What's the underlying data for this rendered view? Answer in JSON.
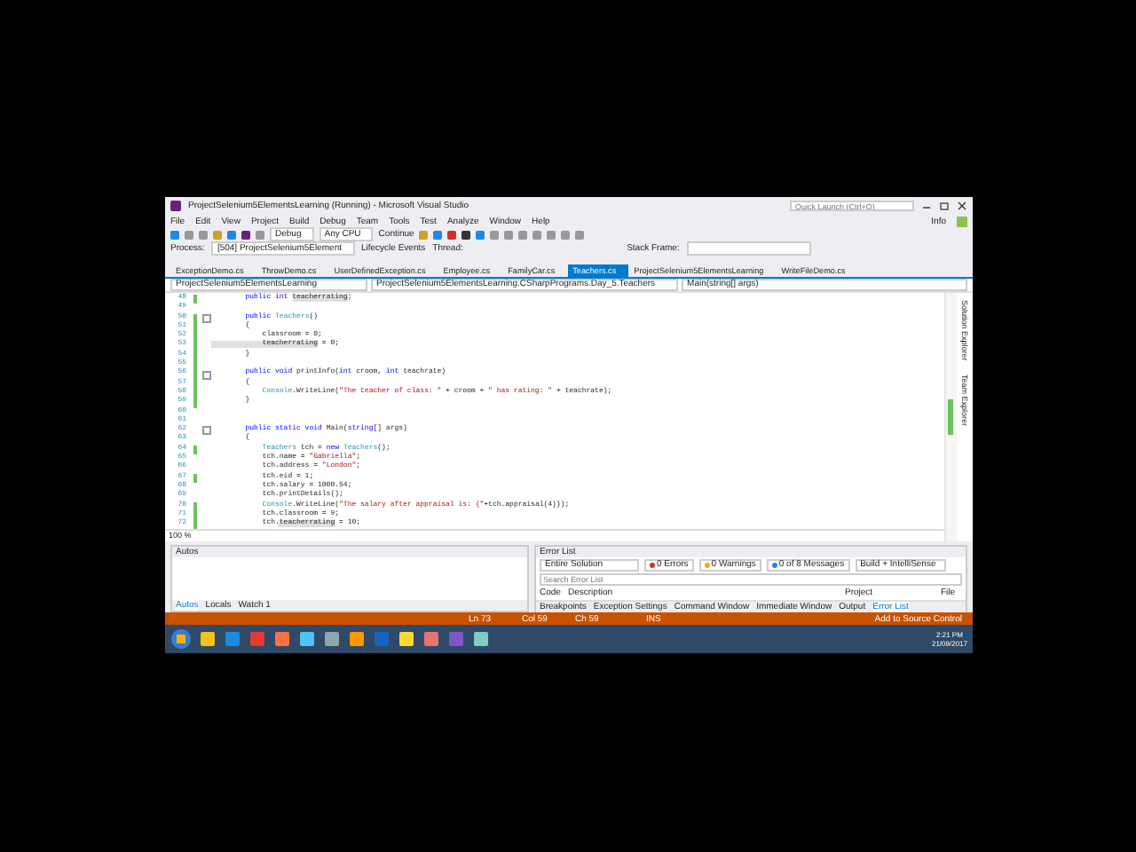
{
  "window": {
    "title": "ProjectSelenium5ElementsLearning (Running) - Microsoft Visual Studio",
    "quick_launch": {
      "placeholder": "Quick Launch (Ctrl+Q)"
    },
    "account": "Info"
  },
  "menu": [
    "File",
    "Edit",
    "View",
    "Project",
    "Build",
    "Debug",
    "Team",
    "Tools",
    "Test",
    "Analyze",
    "Window",
    "Help"
  ],
  "toolbar": {
    "configuration": "Debug",
    "platform": "Any CPU",
    "continue": "Continue"
  },
  "debug_location": {
    "process_label": "Process:",
    "process": "[504] ProjectSelenium5Element",
    "lifecycle": "Lifecycle Events",
    "thread_label": "Thread:",
    "stack_label": "Stack Frame:"
  },
  "tabs": [
    {
      "label": "ExceptionDemo.cs",
      "selected": false
    },
    {
      "label": "ThrowDemo.cs",
      "selected": false
    },
    {
      "label": "UserDefinedException.cs",
      "selected": false
    },
    {
      "label": "Employee.cs",
      "selected": false
    },
    {
      "label": "FamilyCar.cs",
      "selected": false
    },
    {
      "label": "Teachers.cs",
      "selected": true
    },
    {
      "label": "ProjectSelenium5ElementsLearning",
      "selected": false
    },
    {
      "label": "WriteFileDemo.cs",
      "selected": false
    }
  ],
  "navigation": {
    "project": "ProjectSelenium5ElementsLearning",
    "type": "ProjectSelenium5ElementsLearning.CSharpPrograms.Day_5.Teachers",
    "member": "Main(string[] args)"
  },
  "code": {
    "lines": [
      {
        "number": "48",
        "changed": true,
        "fold": false,
        "segs": [
          {
            "text": "        public int ",
            "kind": "kw"
          },
          {
            "text": "teacherrating",
            "kind": "ref"
          },
          {
            "text": ";",
            "kind": "plain"
          }
        ]
      },
      {
        "number": "49",
        "changed": false,
        "fold": false
      },
      {
        "number": "50",
        "changed": true,
        "fold": true,
        "segs": [
          {
            "text": "        public ",
            "kind": "kw"
          },
          {
            "text": "Teachers",
            "kind": "type"
          },
          {
            "text": "()",
            "kind": "plain"
          }
        ]
      },
      {
        "number": "51",
        "changed": true,
        "fold": false,
        "segs": [
          {
            "text": "        {",
            "kind": "plain"
          }
        ]
      },
      {
        "number": "52",
        "changed": true,
        "fold": false,
        "segs": [
          {
            "text": "            classroom = 0;",
            "kind": "plain"
          }
        ]
      },
      {
        "number": "53",
        "changed": true,
        "fold": false,
        "segs": [
          {
            "text": "            teacherrating",
            "kind": "ref"
          },
          {
            "text": " = 0;",
            "kind": "plain"
          }
        ]
      },
      {
        "number": "54",
        "changed": true,
        "fold": false,
        "segs": [
          {
            "text": "        }",
            "kind": "plain"
          }
        ]
      },
      {
        "number": "55",
        "changed": true,
        "fold": false
      },
      {
        "number": "56",
        "changed": true,
        "fold": true,
        "segs": [
          {
            "text": "        public void ",
            "kind": "kw"
          },
          {
            "text": "printInfo(",
            "kind": "plain"
          },
          {
            "text": "int ",
            "kind": "kw"
          },
          {
            "text": "croom, ",
            "kind": "plain"
          },
          {
            "text": "int ",
            "kind": "kw"
          },
          {
            "text": "teachrate)",
            "kind": "plain"
          }
        ]
      },
      {
        "number": "57",
        "changed": true,
        "fold": false,
        "segs": [
          {
            "text": "        {",
            "kind": "plain"
          }
        ]
      },
      {
        "number": "58",
        "changed": true,
        "fold": false,
        "segs": [
          {
            "text": "            Console",
            "kind": "type"
          },
          {
            "text": ".WriteLine(",
            "kind": "plain"
          },
          {
            "text": "\"The teacher of class: \"",
            "kind": "str"
          },
          {
            "text": " + croom + ",
            "kind": "plain"
          },
          {
            "text": "\" has rating: \"",
            "kind": "str"
          },
          {
            "text": " + teachrate);",
            "kind": "plain"
          }
        ]
      },
      {
        "number": "59",
        "changed": true,
        "fold": false,
        "segs": [
          {
            "text": "        }",
            "kind": "plain"
          }
        ]
      },
      {
        "number": "60",
        "changed": false,
        "fold": false
      },
      {
        "number": "61",
        "changed": false,
        "fold": false
      },
      {
        "number": "62",
        "changed": false,
        "fold": true,
        "segs": [
          {
            "text": "        public static void ",
            "kind": "kw"
          },
          {
            "text": "Main(",
            "kind": "plain"
          },
          {
            "text": "string",
            "kind": "kw"
          },
          {
            "text": "[] args)",
            "kind": "plain"
          }
        ]
      },
      {
        "number": "63",
        "changed": false,
        "fold": false,
        "segs": [
          {
            "text": "        {",
            "kind": "plain"
          }
        ]
      },
      {
        "number": "64",
        "changed": true,
        "fold": false,
        "segs": [
          {
            "text": "            Teachers",
            "kind": "type"
          },
          {
            "text": " tch = ",
            "kind": "plain"
          },
          {
            "text": "new ",
            "kind": "kw"
          },
          {
            "text": "Teachers",
            "kind": "type"
          },
          {
            "text": "();",
            "kind": "plain"
          }
        ]
      },
      {
        "number": "65",
        "changed": false,
        "fold": false,
        "segs": [
          {
            "text": "            tch.name = ",
            "kind": "plain"
          },
          {
            "text": "\"Gabriella\"",
            "kind": "str"
          },
          {
            "text": ";",
            "kind": "plain"
          }
        ]
      },
      {
        "number": "66",
        "changed": false,
        "fold": false,
        "segs": [
          {
            "text": "            tch.address = ",
            "kind": "plain"
          },
          {
            "text": "\"London\"",
            "kind": "str"
          },
          {
            "text": ";",
            "kind": "plain"
          }
        ]
      },
      {
        "number": "67",
        "changed": true,
        "fold": false,
        "segs": [
          {
            "text": "            tch.eid = 1;",
            "kind": "plain"
          }
        ]
      },
      {
        "number": "68",
        "changed": false,
        "fold": false,
        "segs": [
          {
            "text": "            tch.salary = 1000.54;",
            "kind": "plain"
          }
        ]
      },
      {
        "number": "69",
        "changed": false,
        "fold": false,
        "segs": [
          {
            "text": "            tch.printDetails();",
            "kind": "plain"
          }
        ]
      },
      {
        "number": "70",
        "changed": true,
        "fold": false,
        "segs": [
          {
            "text": "            Console",
            "kind": "type"
          },
          {
            "text": ".WriteLine(",
            "kind": "plain"
          },
          {
            "text": "\"The salary after appraisal is: {\"",
            "kind": "str"
          },
          {
            "text": "+tch.appraisal(4)});",
            "kind": "plain"
          }
        ]
      },
      {
        "number": "71",
        "changed": true,
        "fold": false,
        "segs": [
          {
            "text": "            tch.classroom = 9;",
            "kind": "plain"
          }
        ]
      },
      {
        "number": "72",
        "changed": true,
        "fold": false,
        "segs": [
          {
            "text": "            tch.",
            "kind": "plain"
          },
          {
            "text": "teacherrating",
            "kind": "ref"
          },
          {
            "text": " = 10;",
            "kind": "plain"
          }
        ]
      }
    ],
    "zoom": "100 %"
  },
  "side_tabs": [
    "Solution Explorer",
    "Team Explorer"
  ],
  "autos": {
    "title": "Autos",
    "tabs": [
      {
        "label": "Autos",
        "selected": true
      },
      {
        "label": "Locals",
        "selected": false
      },
      {
        "label": "Watch 1",
        "selected": false
      }
    ]
  },
  "error_list": {
    "title": "Error List",
    "scope": "Entire Solution",
    "errors": "0 Errors",
    "warnings": "0 Warnings",
    "messages": "0 of 8 Messages",
    "source": "Build + IntelliSense",
    "search": {
      "placeholder": "Search Error List"
    },
    "columns": [
      "Code",
      "Description",
      "Project",
      "File"
    ],
    "tabs": [
      {
        "label": "Breakpoints",
        "selected": false
      },
      {
        "label": "Exception Settings",
        "selected": false
      },
      {
        "label": "Command Window",
        "selected": false
      },
      {
        "label": "Immediate Window",
        "selected": false
      },
      {
        "label": "Output",
        "selected": false
      },
      {
        "label": "Error List",
        "selected": true
      }
    ]
  },
  "status_bar": {
    "line": "Ln 73",
    "column": "Col 59",
    "char": "Ch 59",
    "mode": "INS",
    "source_control": "Add to Source Control"
  },
  "taskbar": {
    "time": "2:21 PM",
    "date": "21/09/2017"
  }
}
